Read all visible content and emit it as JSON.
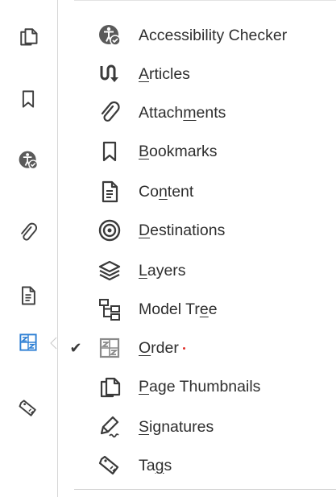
{
  "rail": {
    "items": [
      {
        "name": "page-thumbnails",
        "icon": "pages-icon"
      },
      {
        "name": "bookmarks",
        "icon": "bookmark-icon"
      },
      {
        "name": "accessibility",
        "icon": "accessibility-icon"
      },
      {
        "name": "attachments",
        "icon": "paperclip-icon"
      },
      {
        "name": "content",
        "icon": "document-icon"
      },
      {
        "name": "order",
        "icon": "order-icon",
        "active": true
      },
      {
        "name": "tags",
        "icon": "tag-icon"
      }
    ],
    "active_color": "#2d7fd4"
  },
  "menu": {
    "items": [
      {
        "label": "Accessibility Checker",
        "icon": "accessibility-icon",
        "checked": false
      },
      {
        "label": "Articles",
        "icon": "articles-icon",
        "checked": false
      },
      {
        "label": "Attachments",
        "icon": "paperclip-icon",
        "checked": false
      },
      {
        "label": "Bookmarks",
        "icon": "bookmark-icon",
        "checked": false
      },
      {
        "label": "Content",
        "icon": "document-icon",
        "checked": false
      },
      {
        "label": "Destinations",
        "icon": "target-icon",
        "checked": false
      },
      {
        "label": "Layers",
        "icon": "layers-icon",
        "checked": false
      },
      {
        "label": "Model Tree",
        "icon": "tree-icon",
        "checked": false
      },
      {
        "label": "Order",
        "icon": "order-icon",
        "checked": true
      },
      {
        "label": "Page Thumbnails",
        "icon": "pages-icon",
        "checked": false
      },
      {
        "label": "Signatures",
        "icon": "signature-pen-icon",
        "checked": false
      },
      {
        "label": "Tags",
        "icon": "tag-icon",
        "checked": false
      }
    ],
    "check_glyph": "✔"
  }
}
